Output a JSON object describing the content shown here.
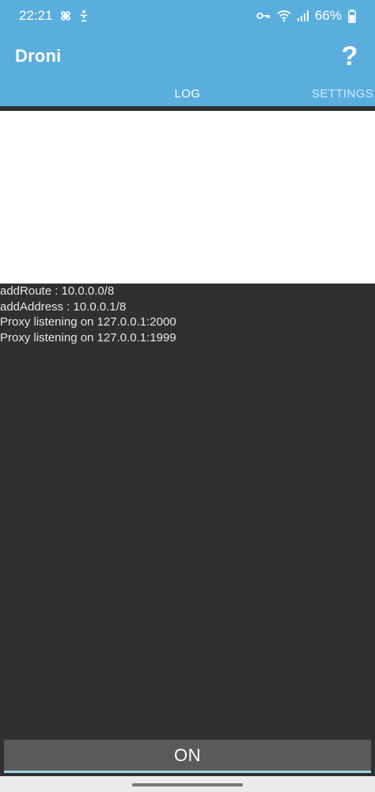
{
  "status_bar": {
    "time": "22:21",
    "battery": "66%",
    "icons": [
      "command-icon",
      "accessibility-icon",
      "vpn-key-icon",
      "wifi-icon",
      "signal-icon",
      "battery-icon"
    ]
  },
  "app_bar": {
    "title": "Droni",
    "help_label": "?"
  },
  "tabs": [
    {
      "label": "LOG",
      "selected": true
    },
    {
      "label": "SETTINGS",
      "selected": false
    }
  ],
  "log": {
    "lines": [
      "addRoute : 10.0.0.0/8",
      "addAddress : 10.0.0.1/8",
      "Proxy listening on 127.0.0.1:2000",
      "Proxy listening on 127.0.0.1:1999"
    ]
  },
  "toggle_button": {
    "label": "ON"
  },
  "colors": {
    "accent": "#5aaede",
    "background": "#303030",
    "button": "#5a5a5a"
  }
}
